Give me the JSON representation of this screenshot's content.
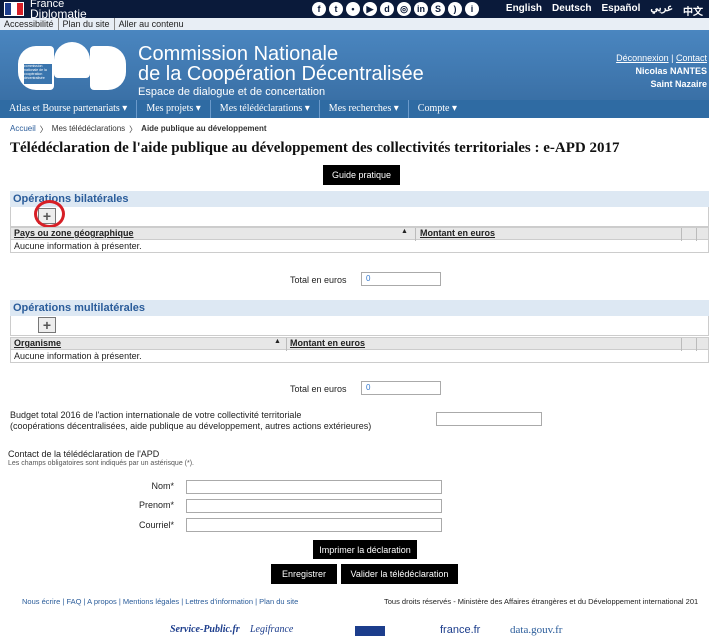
{
  "topbar": {
    "brand_line1": "France",
    "brand_line2": "Diplomatie",
    "social_icons": [
      "facebook-icon",
      "twitter-icon",
      "flickr-icon",
      "youtube-icon",
      "dailymotion-icon",
      "instagram-icon",
      "linkedin-icon",
      "storify-icon",
      "rss-icon",
      "info-icon"
    ],
    "languages": [
      "English",
      "Deutsch",
      "Español",
      "عربي",
      "中文"
    ]
  },
  "access_links": [
    "Accessibilité",
    "Plan du site",
    "Aller au contenu"
  ],
  "header": {
    "title_line1": "Commission Nationale",
    "title_line2": "de la Coopération Décentralisée",
    "subtitle": "Espace de dialogue et de concertation",
    "logo_text": "commission nationale de la coopération décentralisée",
    "link_deconnexion": "Déconnexion",
    "link_contact": "Contact",
    "user_name": "Nicolas NANTES",
    "user_city": "Saint Nazaire"
  },
  "nav": [
    "Atlas et Bourse partenariats ▾",
    "Mes projets ▾",
    "Mes télédéclarations ▾",
    "Mes recherches ▾",
    "Compte ▾"
  ],
  "breadcrumb": {
    "home": "Accueil",
    "level2": "Mes télédéclarations",
    "current": "Aide publique au développement"
  },
  "page_title": "Télédéclaration de l'aide publique au développement des collectivités territoriales : e-APD 2017",
  "guide_button": "Guide pratique",
  "bilateral": {
    "title": "Opérations bilatérales",
    "col1": "Pays ou zone géographique",
    "col2": "Montant en euros",
    "empty": "Aucune information à présenter.",
    "total_label": "Total en euros",
    "total_value": "0"
  },
  "multilateral": {
    "title": "Opérations multilatérales",
    "col1": "Organisme",
    "col2": "Montant en euros",
    "empty": "Aucune information à présenter.",
    "total_label": "Total en euros",
    "total_value": "0"
  },
  "budget": {
    "line1": "Budget total 2016 de l'action internationale de votre collectivité territoriale",
    "line2": "(coopérations décentralisées, aide publique au développement, autres actions extérieures)",
    "value": ""
  },
  "contact": {
    "title": "Contact de la télédéclaration de l'APD",
    "note": "Les champs obligatoires sont indiqués par un astérisque (*).",
    "nom": "Nom*",
    "prenom": "Prenom*",
    "courriel": "Courriel*"
  },
  "buttons": {
    "print": "Imprimer la déclaration",
    "save": "Enregistrer",
    "validate": "Valider la télédéclaration"
  },
  "footer": {
    "links": "Nous écrire | FAQ | A propos | Mentions légales | Lettres d'information | Plan du site",
    "rights": "Tous droits réservés - Ministère des Affaires étrangères et du Développement international 201"
  },
  "partners": [
    "Service-Public.fr",
    "Legifrance",
    "Gouvernement",
    "france.fr",
    "data.gouv.fr"
  ],
  "colors": {
    "header": "#3a75ae",
    "nav": "#2f6ba3",
    "topbar": "#0a1a3a",
    "accent_red": "#d71f26"
  }
}
